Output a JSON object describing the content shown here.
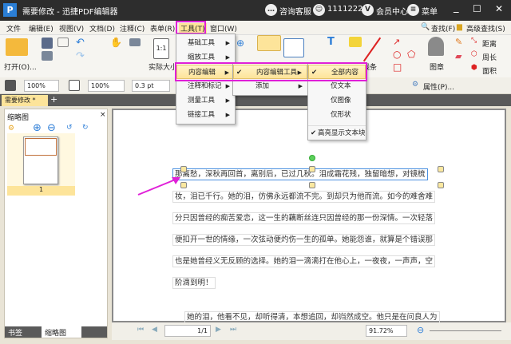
{
  "window": {
    "title": "需要修改 - 迅捷PDF编辑器",
    "support": "咨询客服",
    "user": "1111222...",
    "vip": "会员中心",
    "menu": "菜单"
  },
  "menubar": [
    "文件",
    "编辑(E)",
    "视图(V)",
    "文档(D)",
    "注释(C)",
    "表单(R)",
    "工具(T)",
    "窗口(W)"
  ],
  "search": {
    "find": "查找(F)",
    "advanced": "高级查找(S)"
  },
  "ribbon": {
    "open": "打开(O)...",
    "actual_size": "实际大小",
    "lines": "线条",
    "stamp": "图章",
    "distance": "距离",
    "perimeter": "周长",
    "area": "面积"
  },
  "toolbar2": {
    "fill_opacity": "100%",
    "stroke_opacity": "100%",
    "stroke_width": "0.3 pt",
    "properties": "属性(P)..."
  },
  "tabs": [
    {
      "label": "需要修改 *",
      "active": true
    }
  ],
  "tools_menu": {
    "items": [
      "基础工具",
      "缩放工具",
      "内容编辑",
      "注释和标记",
      "测量工具",
      "链接工具"
    ],
    "highlighted": "内容编辑"
  },
  "content_edit_menu": {
    "items": [
      "内容编辑工具",
      "添加"
    ],
    "checked": "内容编辑工具"
  },
  "content_tool_menu": {
    "items": [
      "全部内容",
      "仅文本",
      "仅图像",
      "仅形状"
    ],
    "checked": "全部内容",
    "highlight_text": "高亮显示文本块"
  },
  "left_panel": {
    "title": "缩略图",
    "page_number": "1",
    "bottom_tabs": [
      "书签",
      "缩略图"
    ]
  },
  "document": {
    "lines": [
      "那离愁，深秋再回首，离别后，已过几秋。泪成霜花残，独留暗想，对镜梳",
      "妆，泪已千行。她的泪，仿佛永远都流不完。到却只为他而流。如今的难舍难",
      "分只因曾经的痴苦爱恋，这一生的藕断丝连只因曾经的那一份深情。一次轻落",
      "便扣开一世的情缘，一次弦动便灼伤一生的孤单。她能怨谁，就算是个错误那",
      "也是她曾经义无反顾的选择。她的泪一滴滴打在他心上，一夜夜，一声声，空",
      "阶滴到明！",
      "她的泪，他看不见，却听得清，本想追回，却岿然成空。他只是在问良人为"
    ]
  },
  "statusbar": {
    "page": "1/1",
    "zoom": "91.72%"
  },
  "colors": {
    "highlight": "#e020d8",
    "accent": "#fde49a",
    "titlebar": "#2d2d2d"
  }
}
